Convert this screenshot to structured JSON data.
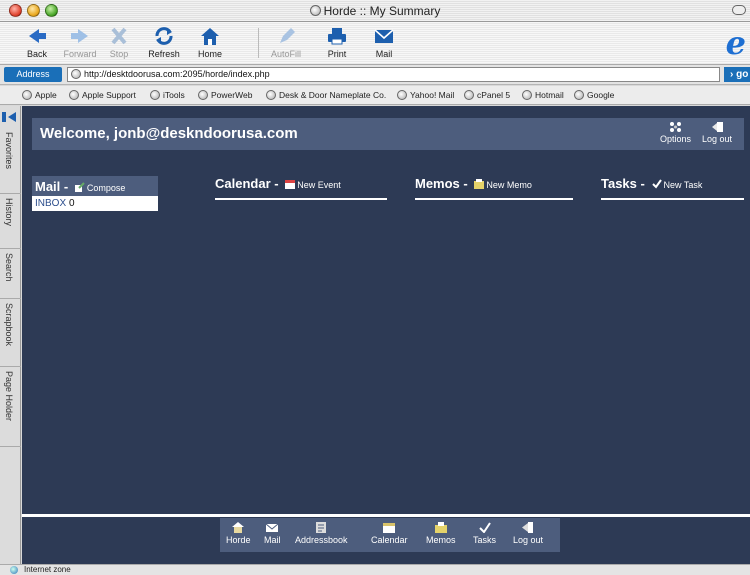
{
  "window": {
    "title": "Horde :: My Summary"
  },
  "toolbar": {
    "back": "Back",
    "forward": "Forward",
    "stop": "Stop",
    "refresh": "Refresh",
    "home": "Home",
    "autofill": "AutoFill",
    "print": "Print",
    "mail": "Mail"
  },
  "address": {
    "label": "Address",
    "url": "http://desktdoorusa.com:2095/horde/index.php",
    "go": "go"
  },
  "favorites": [
    "Apple",
    "Apple Support",
    "iTools",
    "PowerWeb",
    "Desk & Door Nameplate Co.",
    "Yahoo! Mail",
    "cPanel 5",
    "Hotmail",
    "Google"
  ],
  "sidebar": [
    "Favorites",
    "History",
    "Search",
    "Scrapbook",
    "Page Holder"
  ],
  "horde": {
    "welcome": "Welcome, jonb@deskndoorusa.com",
    "options": "Options",
    "logout": "Log out",
    "mail": {
      "title": "Mail",
      "compose": "Compose",
      "folder": "INBOX",
      "count": "0"
    },
    "calendar": {
      "title": "Calendar",
      "action": "New Event"
    },
    "memos": {
      "title": "Memos",
      "action": "New Memo"
    },
    "tasks": {
      "title": "Tasks",
      "action": "New Task"
    },
    "separator": "-"
  },
  "footer": [
    "Horde",
    "Mail",
    "Addressbook",
    "Calendar",
    "Memos",
    "Tasks",
    "Log out"
  ],
  "status": "Internet zone"
}
